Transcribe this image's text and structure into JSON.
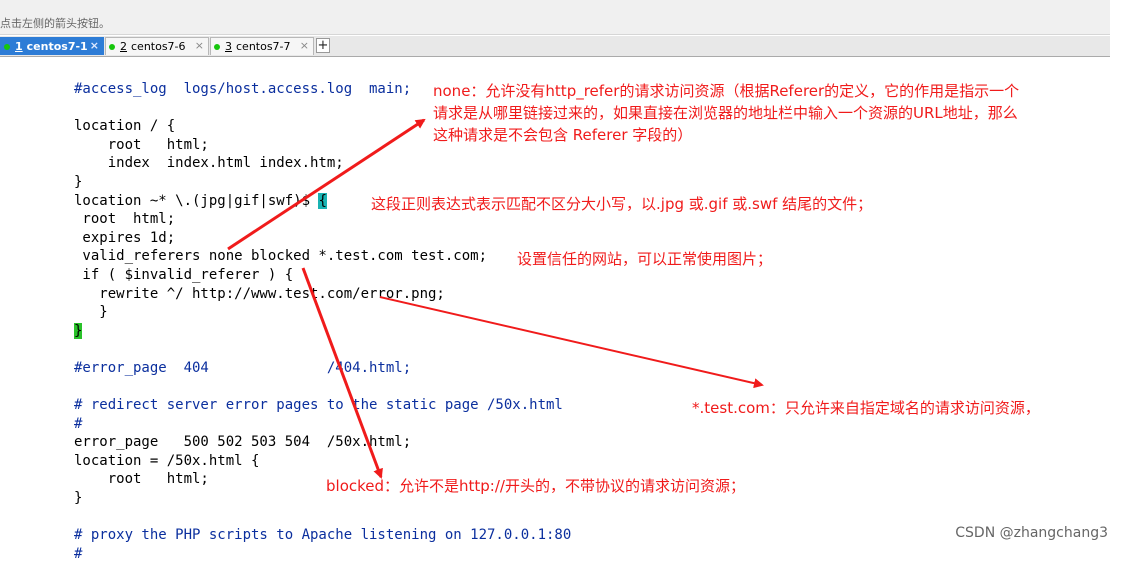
{
  "top": {
    "faded_title": "",
    "hint": "点击左侧的箭头按钮。"
  },
  "tabs": [
    {
      "num": "1",
      "label": "centos7-1",
      "close": "×",
      "active": true
    },
    {
      "num": "2",
      "label": "centos7-6",
      "close": "×",
      "active": false
    },
    {
      "num": "3",
      "label": "centos7-7",
      "close": "×",
      "active": false
    }
  ],
  "new_tab": "+",
  "code": [
    "#access_log  logs/host.access.log  main;",
    "",
    "location / {",
    "    root   html;",
    "    index  index.html index.htm;",
    "}",
    "location ~* \\.(jpg|gif|swf)$ ",
    " root  html;",
    " expires 1d;",
    " valid_referers none blocked *.test.com test.com;",
    " if ( $invalid_referer ) {",
    "   rewrite ^/ http://www.test.com/error.png;",
    "   }",
    "",
    "",
    "#error_page  404              /404.html;",
    "",
    "# redirect server error pages to the static page /50x.html",
    "#",
    "error_page   500 502 503 504  /50x.html;",
    "location = /50x.html {",
    "    root   html;",
    "}",
    "",
    "# proxy the PHP scripts to Apache listening on 127.0.0.1:80",
    "#"
  ],
  "cursor_chars": {
    "brace_open": "{",
    "brace_close": "}"
  },
  "annotations": {
    "none_line1": "none：允许没有http_refer的请求访问资源（根据Referer的定义，它的作用是指示一个",
    "none_line2": "请求是从哪里链接过来的，如果直接在浏览器的地址栏中输入一个资源的URL地址，那么",
    "none_line3": "这种请求是不会包含 Referer 字段的）",
    "regex": "这段正则表达式表示匹配不区分大小写，以.jpg 或.gif 或.swf 结尾的文件；",
    "trusted": "设置信任的网站，可以正常使用图片；",
    "testcom": "*.test.com：只允许来自指定域名的请求访问资源，",
    "blocked": "blocked：允许不是http://开头的，不带协议的请求访问资源；"
  },
  "watermark": "CSDN @zhangchang3",
  "colors": {
    "annotation": "#f01b1b",
    "comment": "#0b2f9e",
    "tab_active": "#2d7cd6",
    "status_dot": "#16c60c"
  }
}
